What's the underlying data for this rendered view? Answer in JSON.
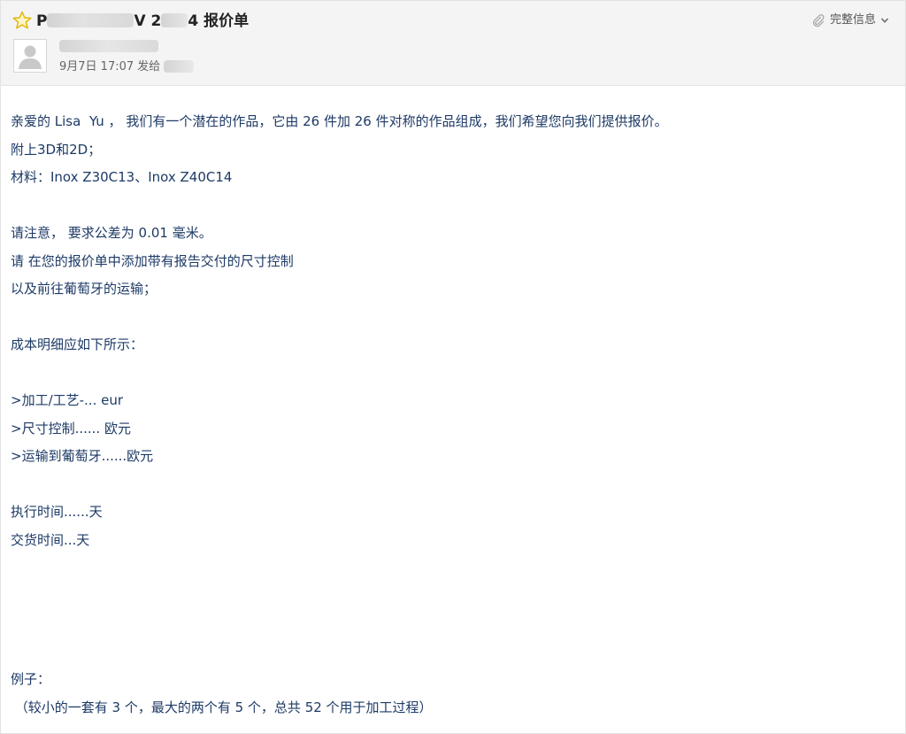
{
  "header": {
    "subject_prefix": "P",
    "subject_mid": "V 2",
    "subject_suffix": "4 报价单",
    "full_info_label": "完整信息",
    "date_time": "9月7日 17:07",
    "sent_to_label": "发给"
  },
  "icons": {
    "star": "star-icon",
    "attachment": "paperclip-icon",
    "expand": "chevron-down-icon",
    "avatar": "user-silhouette-icon"
  },
  "colors": {
    "header_bg": "#f4f4f4",
    "body_text": "#1d3a66",
    "star": "#f2c200"
  },
  "body_lines": [
    "亲爱的 Lisa  Yu ， 我们有一个潜在的作品，它由 26 件加 26 件对称的作品组成，我们希望您向我们提供报价。",
    "附上3D和2D；",
    "材料：Inox Z30C13、Inox Z40C14",
    "",
    "请注意， 要求公差为 0.01 毫米。",
    "请 在您的报价单中添加带有报告交付的尺寸控制",
    "以及前往葡萄牙的运输；",
    "",
    "成本明细应如下所示：",
    "",
    ">加工/工艺-... eur",
    ">尺寸控制...... 欧元",
    ">运输到葡萄牙......欧元",
    "",
    "执行时间......天",
    "交货时间...天",
    "",
    "",
    "",
    "",
    "例子：",
    " （较小的一套有 3 个，最大的两个有 5 个，总共 52 个用于加工过程）"
  ]
}
